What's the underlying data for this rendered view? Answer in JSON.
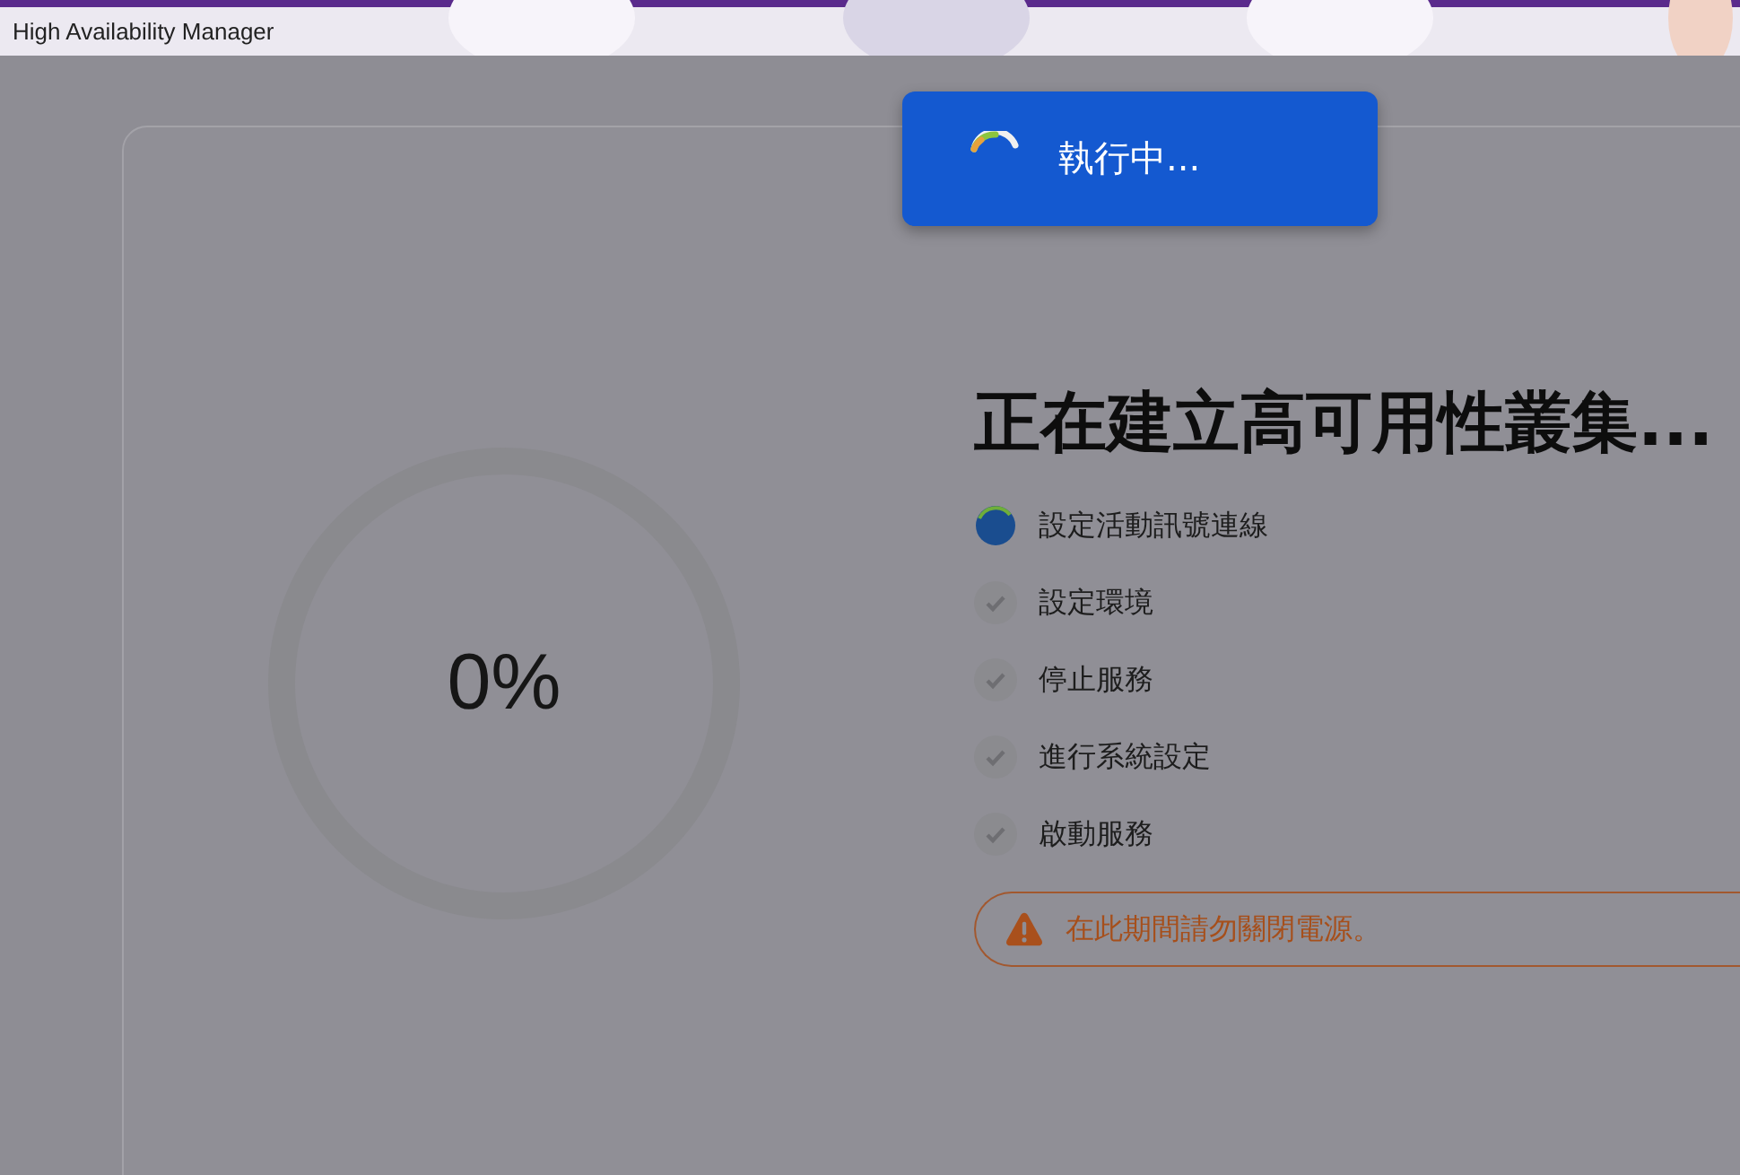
{
  "window": {
    "title": "High Availability Manager"
  },
  "toast": {
    "text": "執行中..."
  },
  "progress": {
    "level": 0,
    "reading": "0%"
  },
  "heading": "正在建立高可用性叢集...",
  "steps": [
    {
      "label": "設定活動訊號連線",
      "kind": "running"
    },
    {
      "label": "設定環境",
      "kind": "pending"
    },
    {
      "label": "停止服務",
      "kind": "pending"
    },
    {
      "label": "進行系統設定",
      "kind": "pending"
    },
    {
      "label": "啟動服務",
      "kind": "pending"
    }
  ],
  "warning": {
    "text": "在此期間請勿關閉電源。"
  }
}
